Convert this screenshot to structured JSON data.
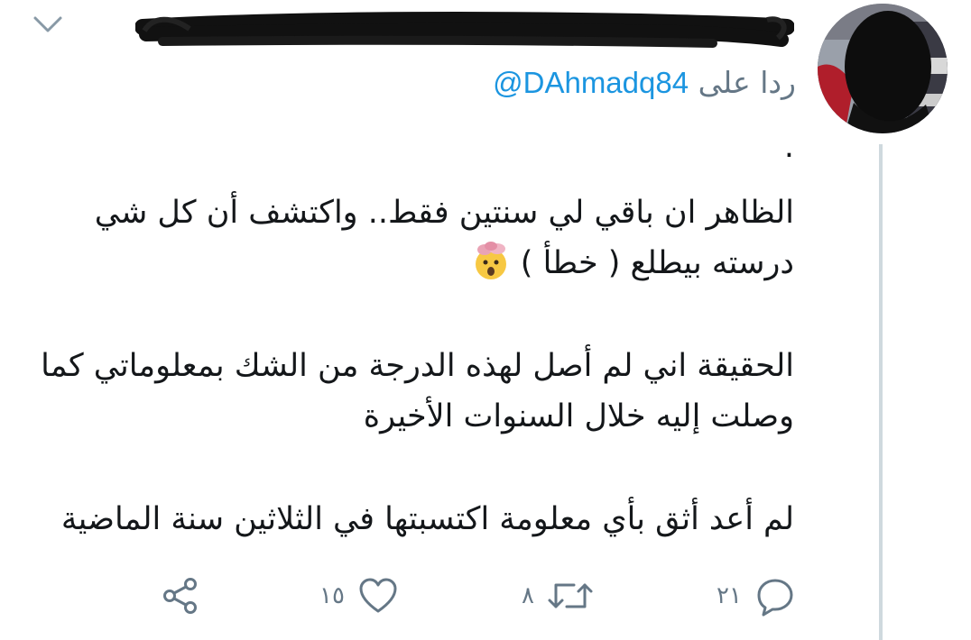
{
  "tweet": {
    "reply_prefix": "ردا على",
    "reply_handle": "@DAhmadq84",
    "paragraphs": {
      "dot": ".",
      "p1": "الظاهر ان باقي لي سنتين فقط.. واكتشف أن كل شي درسته بيطلع ( خطأ )",
      "p2": "الحقيقة اني لم أصل لهذه الدرجة من الشك بمعلوماتي كما وصلت إليه خلال السنوات الأخيرة",
      "p3": "لم أعد أثق بأي معلومة اكتسبتها في الثلاثين سنة الماضية"
    },
    "emoji": "exploding-head",
    "actions": {
      "reply_count": "٢١",
      "retweet_count": "٨",
      "like_count": "١٥"
    }
  },
  "colors": {
    "link": "#1b95e0",
    "text": "#14171a",
    "muted": "#657786",
    "thread_line": "#cfd9de"
  }
}
